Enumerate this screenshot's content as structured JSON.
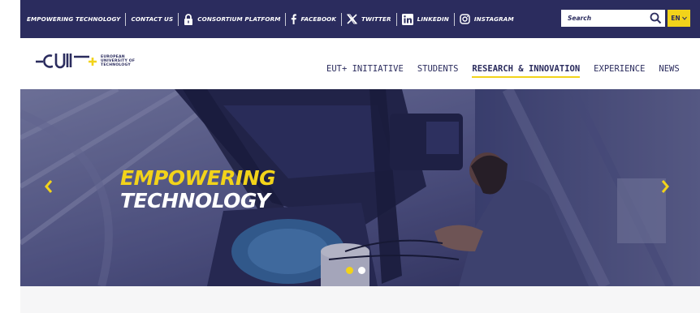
{
  "topbar": {
    "links": [
      {
        "label": "EMPOWERING TECHNOLOGY"
      },
      {
        "label": "CONTACT US"
      },
      {
        "label": "CONSORTIUM PLATFORM",
        "icon": "lock-icon"
      },
      {
        "label": "FACEBOOK",
        "icon": "facebook-icon"
      },
      {
        "label": "TWITTER",
        "icon": "x-twitter-icon"
      },
      {
        "label": "LINKEDIN",
        "icon": "linkedin-icon"
      },
      {
        "label": "INSTAGRAM",
        "icon": "instagram-icon"
      }
    ],
    "search_placeholder": "Search",
    "language": "EN"
  },
  "logo": {
    "line1": "EUROPEAN",
    "line2": "UNIVERSITY OF",
    "line3": "TECHNOLOGY"
  },
  "nav": {
    "items": [
      {
        "label": "EUT+ INITIATIVE",
        "active": false
      },
      {
        "label": "STUDENTS",
        "active": false
      },
      {
        "label": "RESEARCH & INNOVATION",
        "active": true
      },
      {
        "label": "EXPERIENCE",
        "active": false
      },
      {
        "label": "NEWS",
        "active": false
      }
    ]
  },
  "hero": {
    "line1": "EMPOWERING",
    "line2": "TECHNOLOGY",
    "slide_count": 2,
    "active_slide": 1
  },
  "colors": {
    "navy": "#2b2c5e",
    "yellow": "#f2d31a"
  }
}
